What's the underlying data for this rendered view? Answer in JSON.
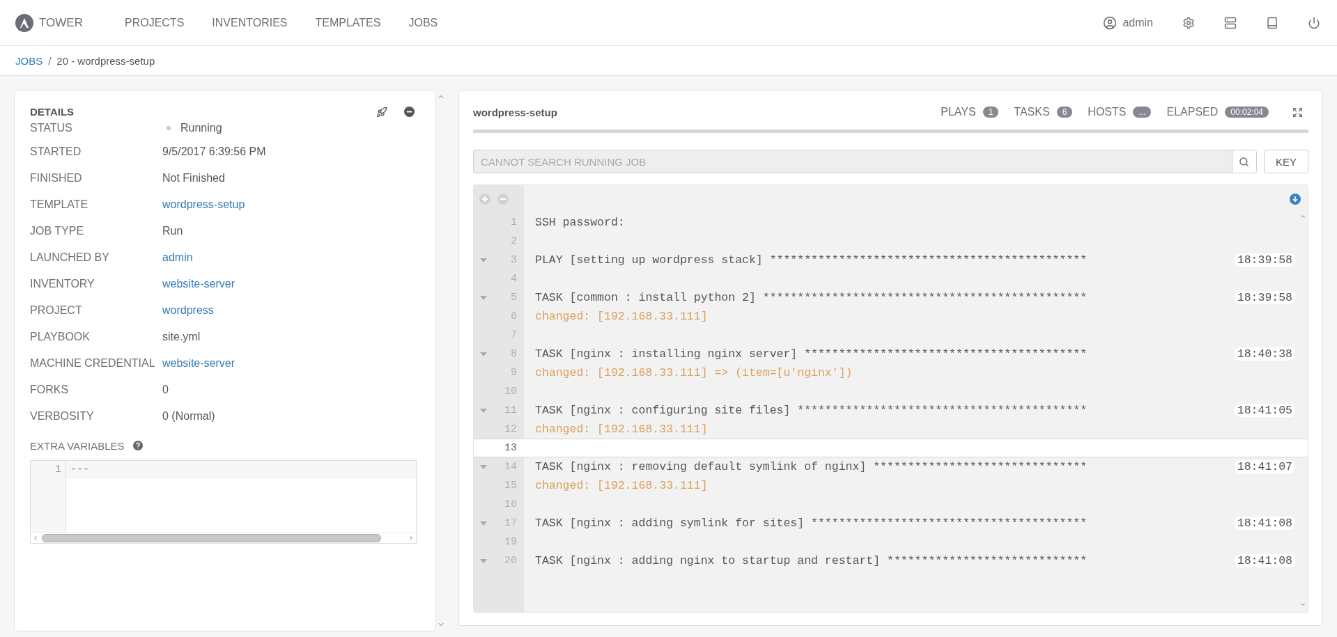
{
  "nav": {
    "brand": "TOWER",
    "items": [
      {
        "label": "PROJECTS"
      },
      {
        "label": "INVENTORIES"
      },
      {
        "label": "TEMPLATES"
      },
      {
        "label": "JOBS"
      }
    ],
    "user": "admin"
  },
  "breadcrumb": {
    "parent": "JOBS",
    "separator": "/",
    "current": "20 - wordpress-setup"
  },
  "details": {
    "title": "DETAILS",
    "fields": [
      {
        "label": "STATUS",
        "value": "Running",
        "kind": "status"
      },
      {
        "label": "STARTED",
        "value": "9/5/2017 6:39:56 PM",
        "kind": "text"
      },
      {
        "label": "FINISHED",
        "value": "Not Finished",
        "kind": "text"
      },
      {
        "label": "TEMPLATE",
        "value": "wordpress-setup",
        "kind": "link"
      },
      {
        "label": "JOB TYPE",
        "value": "Run",
        "kind": "text"
      },
      {
        "label": "LAUNCHED BY",
        "value": "admin",
        "kind": "link"
      },
      {
        "label": "INVENTORY",
        "value": "website-server",
        "kind": "link"
      },
      {
        "label": "PROJECT",
        "value": "wordpress",
        "kind": "link"
      },
      {
        "label": "PLAYBOOK",
        "value": "site.yml",
        "kind": "text"
      },
      {
        "label": "MACHINE CREDENTIAL",
        "value": "website-server",
        "kind": "link"
      },
      {
        "label": "FORKS",
        "value": "0",
        "kind": "text"
      },
      {
        "label": "VERBOSITY",
        "value": "0 (Normal)",
        "kind": "text"
      }
    ],
    "extra_variables": {
      "label": "EXTRA VARIABLES",
      "lines": [
        {
          "number": "1",
          "text": "---"
        }
      ]
    }
  },
  "output": {
    "title": "wordpress-setup",
    "counts": [
      {
        "label": "PLAYS",
        "value": "1"
      },
      {
        "label": "TASKS",
        "value": "6"
      },
      {
        "label": "HOSTS",
        "value": "..."
      },
      {
        "label": "ELAPSED",
        "value": "00:02:04"
      }
    ],
    "search": {
      "placeholder": "CANNOT SEARCH RUNNING JOB",
      "disabled": true
    },
    "key_button": "KEY",
    "lines": [
      {
        "number": "1",
        "text": "SSH password:",
        "kind": "plain",
        "highlighted": false
      },
      {
        "number": "2",
        "kind": "plain",
        "highlighted": false
      },
      {
        "number": "3",
        "text": "PLAY [setting up wordpress stack] **********************************************",
        "kind": "header",
        "time": "18:39:58",
        "highlighted": false
      },
      {
        "number": "4",
        "kind": "plain",
        "highlighted": false
      },
      {
        "number": "5",
        "text": "TASK [common : install python 2] ***********************************************",
        "kind": "header",
        "time": "18:39:58",
        "highlighted": false
      },
      {
        "number": "6",
        "text": "changed: [192.168.33.111]",
        "kind": "changed",
        "highlighted": false
      },
      {
        "number": "7",
        "kind": "plain",
        "highlighted": false
      },
      {
        "number": "8",
        "text": "TASK [nginx : installing nginx server] *****************************************",
        "kind": "header",
        "time": "18:40:38",
        "highlighted": false
      },
      {
        "number": "9",
        "text": "changed: [192.168.33.111] => (item=[u'nginx'])",
        "kind": "changed",
        "highlighted": false
      },
      {
        "number": "10",
        "kind": "plain",
        "highlighted": false
      },
      {
        "number": "11",
        "text": "TASK [nginx : configuring site files] ******************************************",
        "kind": "header",
        "time": "18:41:05",
        "highlighted": false
      },
      {
        "number": "12",
        "text": "changed: [192.168.33.111]",
        "kind": "changed",
        "highlighted": false
      },
      {
        "number": "13",
        "kind": "plain",
        "highlighted": true
      },
      {
        "number": "14",
        "text": "TASK [nginx : removing default symlink of nginx] *******************************",
        "kind": "header",
        "time": "18:41:07",
        "highlighted": false
      },
      {
        "number": "15",
        "text": "changed: [192.168.33.111]",
        "kind": "changed",
        "highlighted": false
      },
      {
        "number": "16",
        "kind": "plain",
        "highlighted": false
      },
      {
        "number": "17",
        "text": "TASK [nginx : adding symlink for sites] ****************************************",
        "kind": "header",
        "time": "18:41:08",
        "highlighted": false
      },
      {
        "number": "19",
        "kind": "plain",
        "highlighted": false
      },
      {
        "number": "20",
        "text": "TASK [nginx : adding nginx to startup and restart] *****************************",
        "kind": "header",
        "time": "18:41:08",
        "highlighted": false
      }
    ]
  }
}
